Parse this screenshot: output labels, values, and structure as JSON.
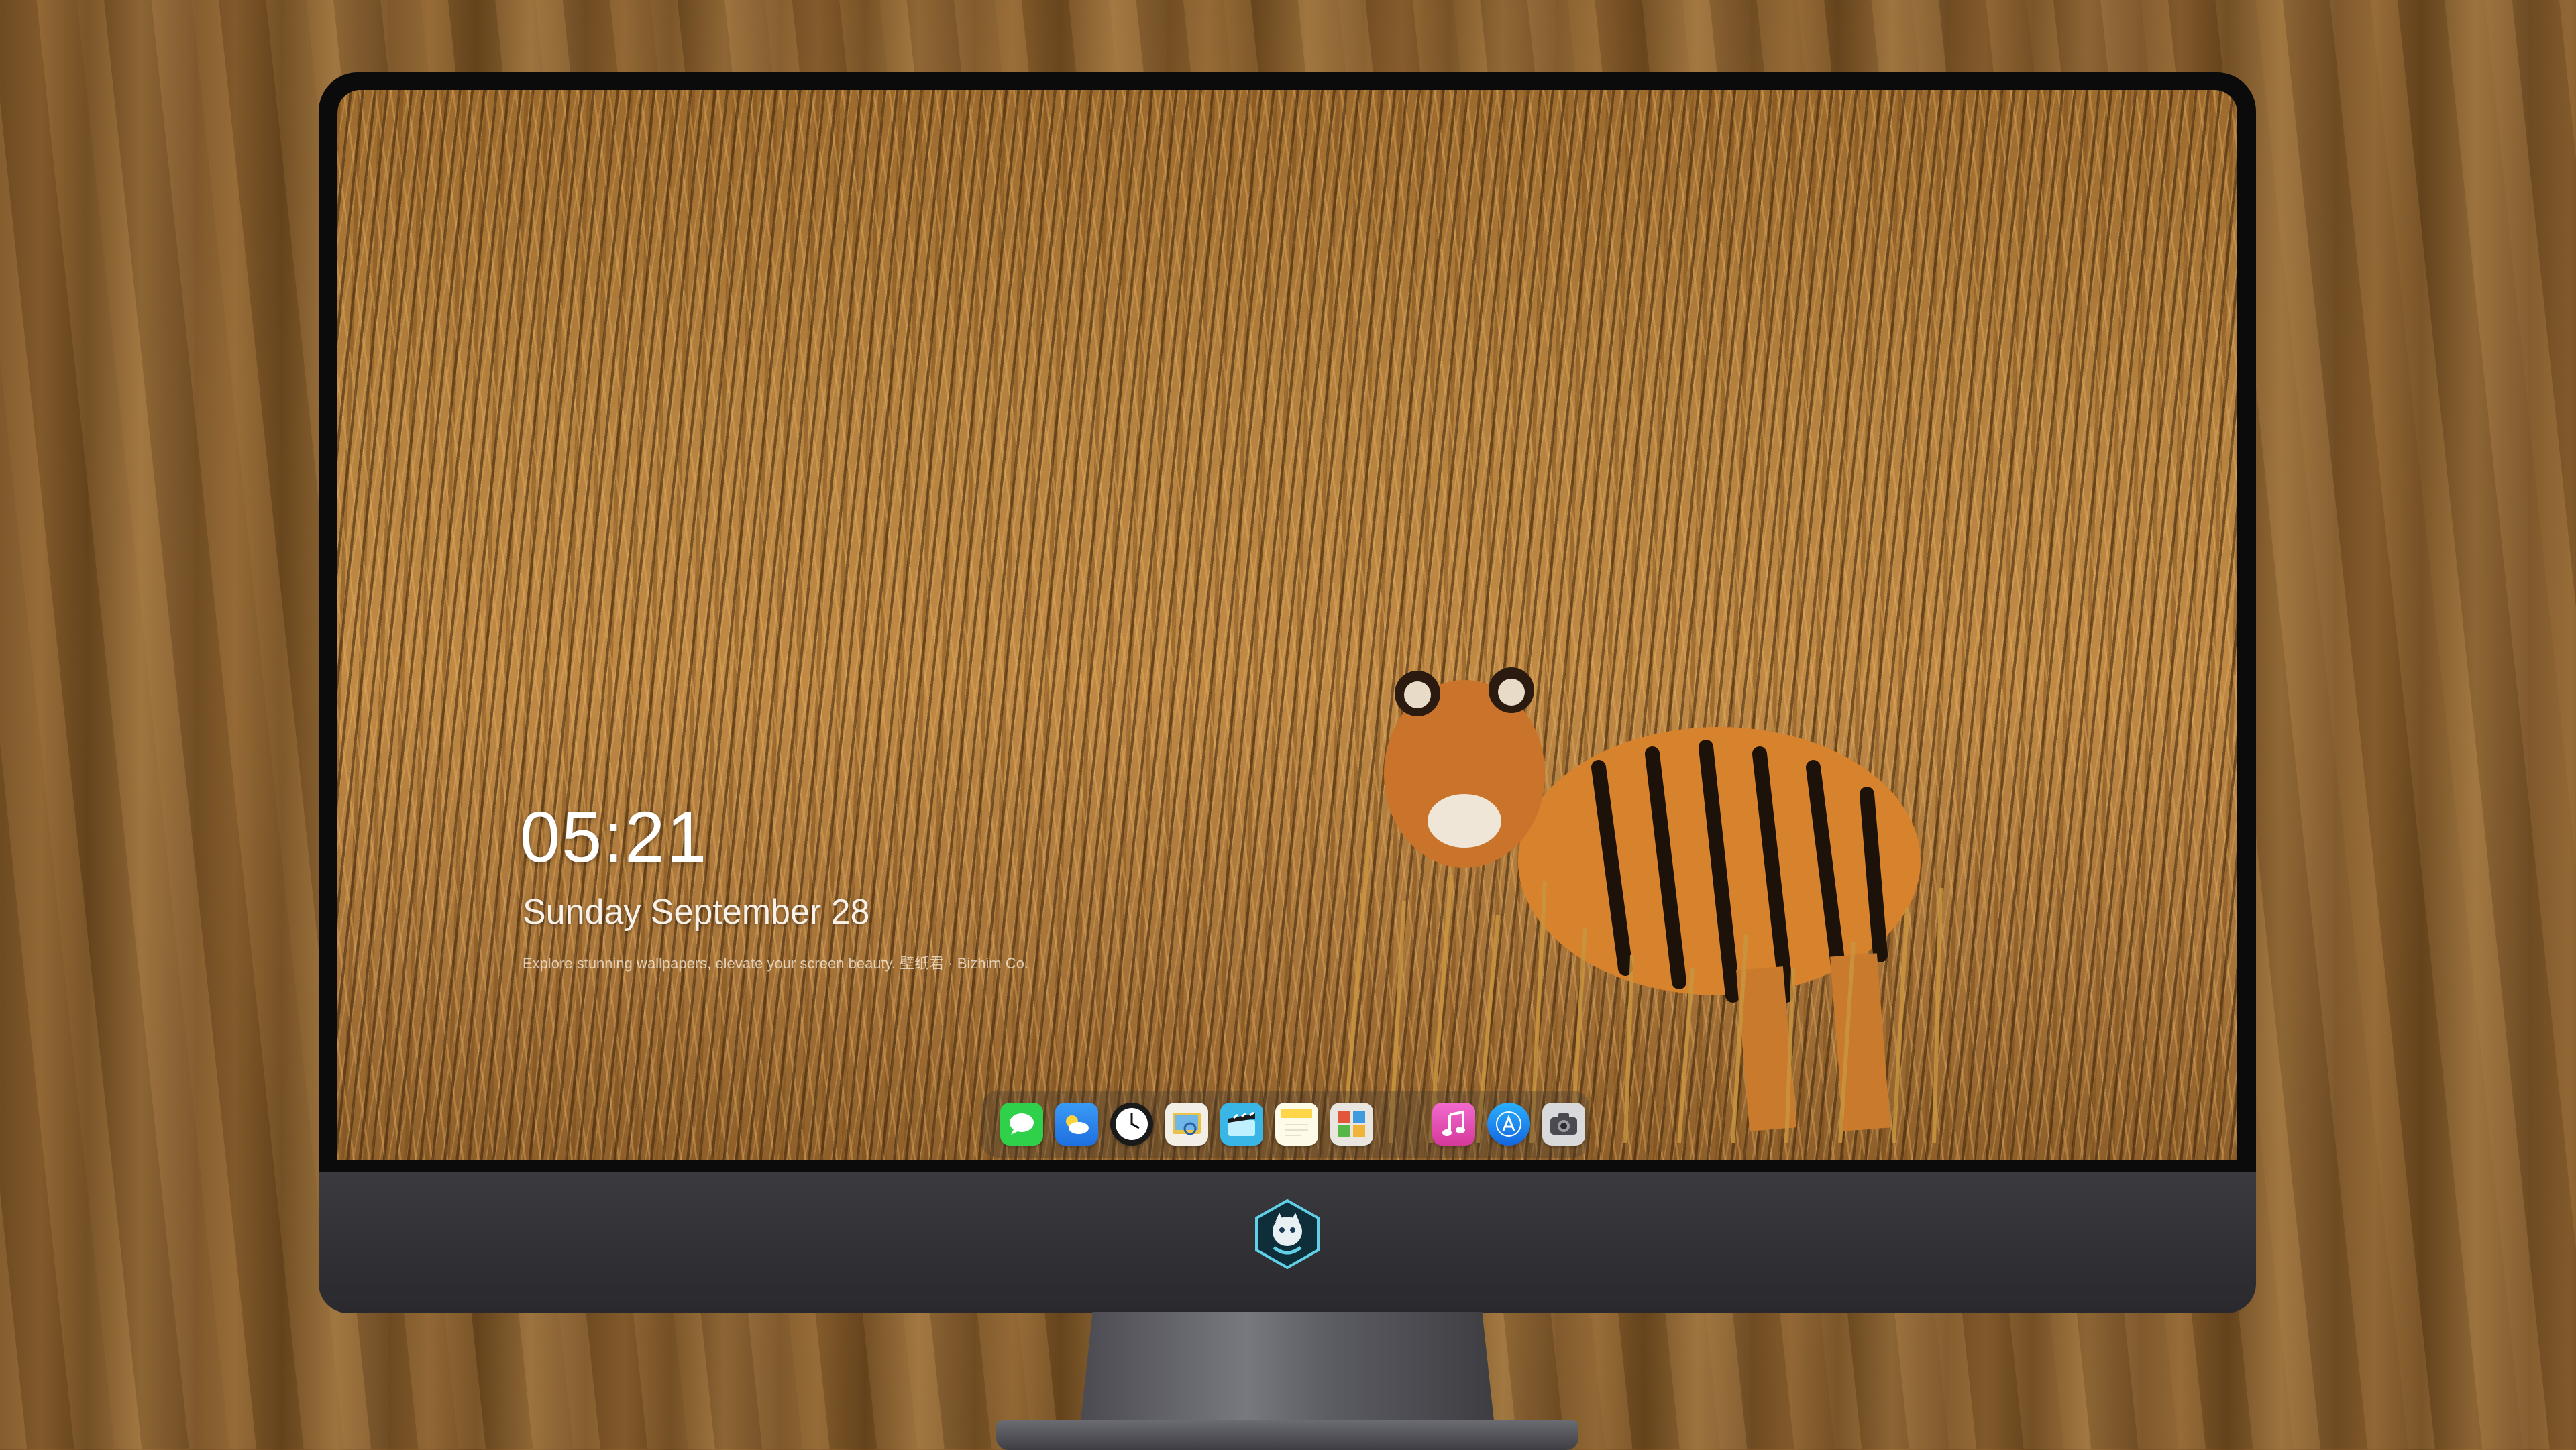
{
  "lock_screen": {
    "time": "05:21",
    "date": "Sunday September  28",
    "tagline": "Explore stunning wallpapers, elevate your screen beauty. 壁纸君 · Bizhim Co."
  },
  "dock": {
    "apps": [
      {
        "name": "messages-icon",
        "color": "#2fd04a"
      },
      {
        "name": "weather-icon",
        "color": "#2f8cf0"
      },
      {
        "name": "clock-icon",
        "color": "#1a1a1a"
      },
      {
        "name": "preview-icon",
        "color": "#e8c34a"
      },
      {
        "name": "clapper-icon",
        "color": "#3ab6e6"
      },
      {
        "name": "notes-icon",
        "color": "#ffd64a"
      },
      {
        "name": "photo-booth-icon",
        "color": "#e9e5df"
      },
      {
        "name": "music-icon",
        "color": "#e04aa8"
      },
      {
        "name": "app-store-icon",
        "color": "#1c8ef0"
      },
      {
        "name": "camera-icon",
        "color": "#6a6a70"
      }
    ]
  },
  "colors": {
    "bezel": "#0b0b0c",
    "chin": "#313136",
    "grass": "#b5823f",
    "tiger": "#d9822b"
  }
}
